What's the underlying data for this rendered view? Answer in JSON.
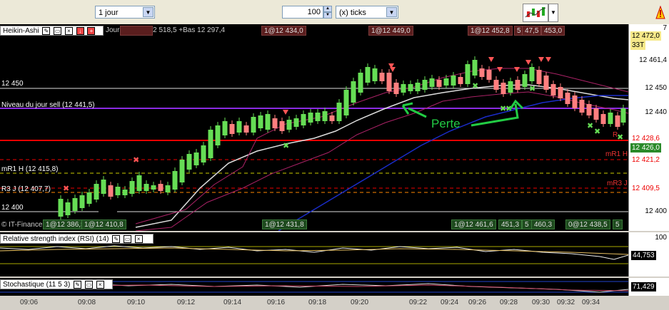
{
  "toolbar": {
    "period": "1 jour",
    "count": "100",
    "unit": "(x) ticks"
  },
  "main": {
    "title": "Heikin-Ashi",
    "daily_info": "Jour 2 · Haut 12 518,5 +Bas 12 297,4",
    "copyright": "© IT-Finance.com, Données cotations",
    "annotation": "Perte",
    "levels": {
      "l12450": "12 450",
      "l12400": "12 400",
      "niveau": "Niveau du jour sell (12 441,5)",
      "mr1": "mR1 H (12 415,8)",
      "r3": "R3 J (12 407,7)"
    },
    "top_boxes": [
      "1@12 434,0",
      "1@12 449,0",
      "1@12 452,8",
      "5",
      "47,5",
      "453,0"
    ],
    "bottom_boxes": [
      "1@12 386,5",
      "1@12 410,8",
      "1@12 431,8",
      "1@12 461,6",
      "451,3",
      "5",
      "460,3",
      "0@12 438,5",
      "5"
    ],
    "right_labels": {
      "r": "R",
      "mr1": "mR1 H",
      "mr3": "mR3 J"
    },
    "axis": {
      "top": "7",
      "price_tag": "12 472,0",
      "ticks_tag": "33T",
      "last": "12 461,4",
      "a12450": "12 450",
      "a12440": "12 440",
      "t1": "12 428,6",
      "t2": "12 426,0",
      "t3": "12 421,2",
      "t4": "12 409,5",
      "a12400": "12 400"
    }
  },
  "rsi": {
    "title": "Relative strength index (RSI) (14)",
    "axis_top": "100",
    "value": "44,753"
  },
  "stoch": {
    "title": "Stochastique (11 5 3)",
    "value": "71,429"
  },
  "time_labels": [
    "09:06",
    "09:08",
    "09:10",
    "09:12",
    "09:14",
    "09:16",
    "09:18",
    "09:20",
    "09:22",
    "09:24",
    "09:26",
    "09:28",
    "09:30",
    "09:32",
    "09:34"
  ],
  "colors": {
    "bull": "#66dd55",
    "bear": "#ff7f7f",
    "accent": "#1a4d8f"
  }
}
